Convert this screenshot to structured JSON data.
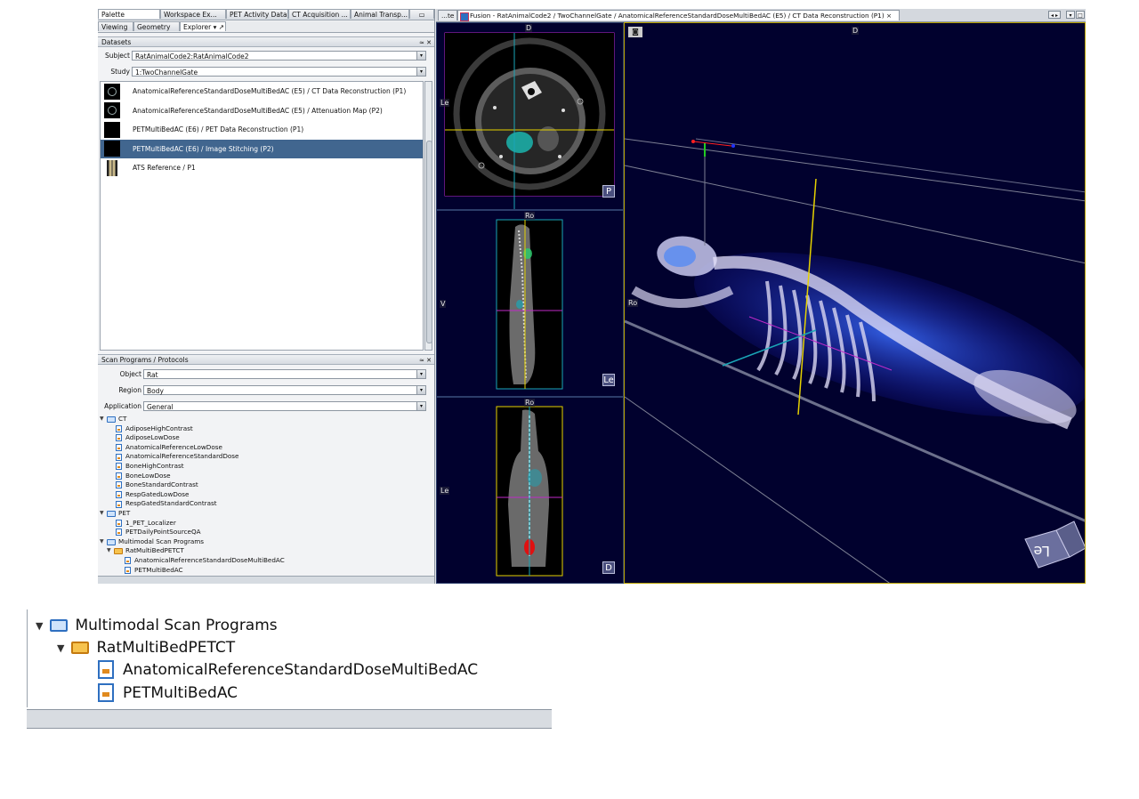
{
  "left_tabs": [
    "Palette",
    "Workspace Ex...",
    "PET Activity Data",
    "CT Acquisition ...",
    "Animal Transp..."
  ],
  "sub_tabs": [
    "Viewing",
    "Geometry",
    "Explorer ▾ ↗"
  ],
  "datasets": {
    "header": "Datasets",
    "subject_label": "Subject",
    "subject_value": "RatAnimalCode2:RatAnimalCode2",
    "study_label": "Study",
    "study_value": "1:TwoChannelGate",
    "items": [
      "AnatomicalReferenceStandardDoseMultiBedAC (E5) / CT Data Reconstruction (P1)",
      "AnatomicalReferenceStandardDoseMultiBedAC (E5) / Attenuation Map (P2)",
      "PETMultiBedAC (E6) / PET Data Reconstruction (P1)",
      "PETMultiBedAC (E6) / Image Stitching (P2)",
      "ATS Reference / P1"
    ],
    "selected_index": 3
  },
  "scan_programs": {
    "header": "Scan Programs / Protocols",
    "object_label": "Object",
    "object_value": "Rat",
    "region_label": "Region",
    "region_value": "Body",
    "application_label": "Application",
    "application_value": "General",
    "tree": {
      "ct": {
        "label": "CT",
        "items": [
          "AdiposeHighContrast",
          "AdiposeLowDose",
          "AnatomicalReferenceLowDose",
          "AnatomicalReferenceStandardDose",
          "BoneHighContrast",
          "BoneLowDose",
          "BoneStandardContrast",
          "RespGatedLowDose",
          "RespGatedStandardContrast"
        ]
      },
      "pet": {
        "label": "PET",
        "items": [
          "1_PET_Localizer",
          "PETDailyPointSourceQA"
        ]
      },
      "multimodal": {
        "label": "Multimodal Scan Programs",
        "folder": "RatMultiBedPETCT",
        "items": [
          "AnatomicalReferenceStandardDoseMultiBedAC",
          "PETMultiBedAC"
        ]
      }
    }
  },
  "editor": {
    "tab_small": "...te",
    "tab_main": "Fusion - RatAnimalCode2 / TwoChannelGate / AnatomicalReferenceStandardDoseMultiBedAC (E5) / CT Data Reconstruction (P1) ×",
    "window_buttons": [
      "◂ ▸",
      "▾",
      "□"
    ]
  },
  "viewports": {
    "axial": {
      "top": "D",
      "left": "Le",
      "corner": "P"
    },
    "sagittal": {
      "top": "Ro",
      "left": "V",
      "corner": "Le"
    },
    "coronal": {
      "top": "Ro",
      "left": "Le",
      "corner": "D"
    },
    "volume": {
      "top": "D",
      "left": "Ro",
      "cube": "Le",
      "camera_icon": "camera-icon"
    }
  },
  "colors": {
    "selection": "#41668f",
    "crosshair_yellow": "#e6d200",
    "crosshair_cyan": "#1aa6b7",
    "crosshair_magenta": "#c02ac8",
    "viewport_bg": "#01012e"
  }
}
